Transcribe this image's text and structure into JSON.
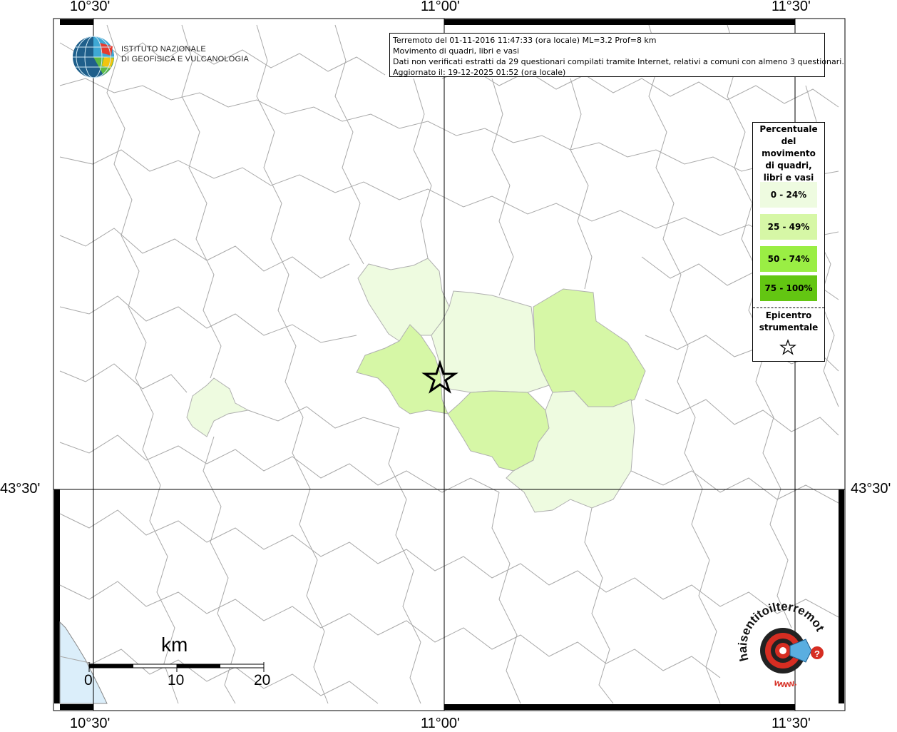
{
  "map": {
    "top_ticks": [
      "10°30'",
      "11°00'",
      "11°30'"
    ],
    "bottom_ticks": [
      "10°30'",
      "11°00'",
      "11°30'"
    ],
    "left_lat": "43°30'",
    "right_lat": "43°30'"
  },
  "info": {
    "line1": "Terremoto del 01-11-2016 11:47:33 (ora locale) ML=3.2 Prof=8 km",
    "line2": "Movimento di quadri, libri e vasi",
    "line3": "Dati non verificati estratti da 29 questionari compilati tramite Internet, relativi a comuni con almeno 3 questionari.",
    "line4": "Aggiornato il: 19-12-2025 01:52 (ora locale)"
  },
  "logo": {
    "line1": "ISTITUTO NAZIONALE",
    "line2": "DI GEOFISICA E VULCANOLOGIA",
    "icon": "ingv-globe-icon"
  },
  "legend": {
    "title": [
      "Percentuale",
      "del",
      "movimento",
      "di quadri,",
      "libri e vasi"
    ],
    "classes": [
      {
        "label": "0 - 24%",
        "color": "#eefbe0"
      },
      {
        "label": "25 - 49%",
        "color": "#d6f7a6"
      },
      {
        "label": "50 - 74%",
        "color": "#9aee44"
      },
      {
        "label": "75 - 100%",
        "color": "#63c612"
      }
    ],
    "epicenter": [
      "Epicentro",
      "strumentale"
    ],
    "epicenter_icon": "star-icon"
  },
  "scale": {
    "unit": "km",
    "labels": [
      "0",
      "10",
      "20"
    ]
  },
  "badge": {
    "text": "haisentitoilterremoto.it",
    "url": "www.",
    "icon": "hai-sentito-il-terremoto-logo"
  },
  "colors": {
    "zone_low": "#eefbe0",
    "zone_mid": "#d6f7a6",
    "sea": "#dbeefa",
    "border": "#a9a9a9"
  }
}
